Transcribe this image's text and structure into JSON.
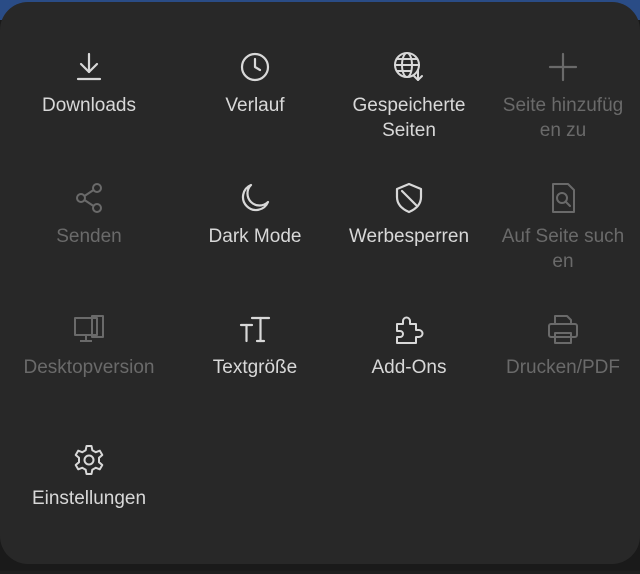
{
  "menu": {
    "items": [
      {
        "label": "Downloads",
        "icon": "download-icon",
        "enabled": true
      },
      {
        "label": "Verlauf",
        "icon": "clock-icon",
        "enabled": true
      },
      {
        "label": "Gespeicherte Seiten",
        "icon": "saved-pages-globe-icon",
        "enabled": true
      },
      {
        "label": "Seite hinzufügen zu",
        "icon": "plus-icon",
        "enabled": false
      },
      {
        "label": "Senden",
        "icon": "share-icon",
        "enabled": false
      },
      {
        "label": "Dark Mode",
        "icon": "moon-icon",
        "enabled": true
      },
      {
        "label": "Werbesperren",
        "icon": "shield-icon",
        "enabled": true
      },
      {
        "label": "Auf Seite suchen",
        "icon": "find-in-page-icon",
        "enabled": false
      },
      {
        "label": "Desktopversion",
        "icon": "desktop-icon",
        "enabled": false
      },
      {
        "label": "Textgröße",
        "icon": "text-size-icon",
        "enabled": true
      },
      {
        "label": "Add-Ons",
        "icon": "puzzle-icon",
        "enabled": true
      },
      {
        "label": "Drucken/PDF",
        "icon": "printer-icon",
        "enabled": false
      },
      {
        "label": "Einstellungen",
        "icon": "gear-icon",
        "enabled": true
      }
    ]
  },
  "colors": {
    "sheet_background": "#282828",
    "enabled_text": "#d8d8d8",
    "disabled_text": "#6a6a6a",
    "top_bar": "#2a4c86"
  }
}
